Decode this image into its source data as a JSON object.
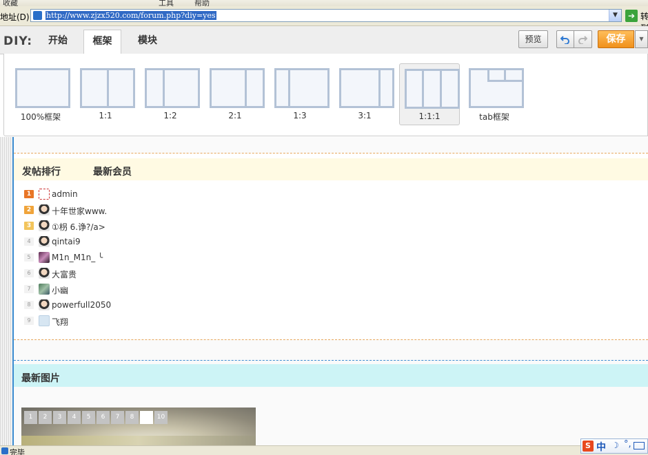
{
  "browser": {
    "top_strip": [
      "收藏",
      "工具",
      "帮助"
    ],
    "address_label": "地址(D)",
    "url": "http://www.zjzx520.com/forum.php?diy=yes",
    "go_label": "转到"
  },
  "diy_toolbar": {
    "title": "DIY:",
    "tabs": [
      {
        "label": "开始",
        "active": false
      },
      {
        "label": "框架",
        "active": true
      },
      {
        "label": "模块",
        "active": false
      }
    ],
    "preview_label": "预览",
    "save_label": "保存"
  },
  "frames": [
    {
      "label": "100%框架",
      "columns": 1,
      "selected": false
    },
    {
      "label": "1:1",
      "columns": 2,
      "selected": false
    },
    {
      "label": "1:2",
      "columns": 2,
      "selected": false
    },
    {
      "label": "2:1",
      "columns": 2,
      "selected": false
    },
    {
      "label": "1:3",
      "columns": 2,
      "selected": false
    },
    {
      "label": "3:1",
      "columns": 2,
      "selected": false
    },
    {
      "label": "1:1:1",
      "columns": 3,
      "selected": true
    },
    {
      "label": "tab框架",
      "columns": 1,
      "selected": false
    }
  ],
  "ranking_block": {
    "tabs": [
      "发帖排行",
      "最新会员"
    ],
    "rows": [
      {
        "rank": "1",
        "name": "admin",
        "badge_color": "#e87526"
      },
      {
        "rank": "2",
        "name": "十年世家www.",
        "badge_color": "#f0a43a"
      },
      {
        "rank": "3",
        "name": "①枴 6.诤?/a>",
        "badge_color": "#f2c45b"
      },
      {
        "rank": "4",
        "name": "qintai9"
      },
      {
        "rank": "5",
        "name": "M1n_M1n_ ╰"
      },
      {
        "rank": "6",
        "name": "大富贵"
      },
      {
        "rank": "7",
        "name": "小幽"
      },
      {
        "rank": "8",
        "name": "powerfull2050"
      },
      {
        "rank": "9",
        "name": "飞翔"
      }
    ]
  },
  "photo_block": {
    "title": "最新图片",
    "pages": [
      "1",
      "2",
      "3",
      "4",
      "5",
      "6",
      "7",
      "8",
      "",
      "10"
    ],
    "active_page_index": 8
  },
  "status_bar": {
    "text": "完毕"
  },
  "ime": {
    "logo": "S",
    "mode": "中",
    "moon": "☽",
    "punct": "°,"
  },
  "colors": {
    "save_button": "#f0901b",
    "ranking_header_bg": "#fffae3",
    "photo_header_bg": "#cdf4f6",
    "frame_border": "#b3c2d6"
  }
}
